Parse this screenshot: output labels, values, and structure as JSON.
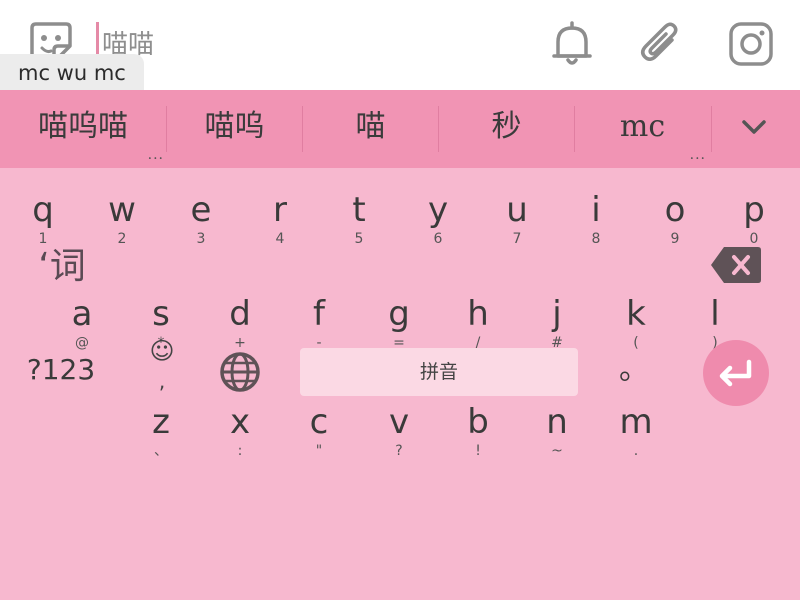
{
  "input": {
    "text": "喵喵",
    "composition": "mc wu mc"
  },
  "topbar": {
    "icons": [
      "emoji-sticker-icon",
      "bell-icon",
      "paperclip-icon",
      "instagram-icon"
    ]
  },
  "candidates": {
    "items": [
      "喵呜喵",
      "喵呜",
      "喵",
      "秒",
      "mc"
    ],
    "more_marker": "...",
    "expand_icon": "chevron-down-icon"
  },
  "keyboard": {
    "row1": [
      {
        "main": "q",
        "sub": "1"
      },
      {
        "main": "w",
        "sub": "2"
      },
      {
        "main": "e",
        "sub": "3"
      },
      {
        "main": "r",
        "sub": "4"
      },
      {
        "main": "t",
        "sub": "5"
      },
      {
        "main": "y",
        "sub": "6"
      },
      {
        "main": "u",
        "sub": "7"
      },
      {
        "main": "i",
        "sub": "8"
      },
      {
        "main": "o",
        "sub": "9"
      },
      {
        "main": "p",
        "sub": "0"
      }
    ],
    "row2": [
      {
        "main": "a",
        "sub": "@"
      },
      {
        "main": "s",
        "sub": "*"
      },
      {
        "main": "d",
        "sub": "+"
      },
      {
        "main": "f",
        "sub": "-"
      },
      {
        "main": "g",
        "sub": "="
      },
      {
        "main": "h",
        "sub": "/"
      },
      {
        "main": "j",
        "sub": "#"
      },
      {
        "main": "k",
        "sub": "("
      },
      {
        "main": "l",
        "sub": ")"
      }
    ],
    "row3": [
      {
        "main": "z",
        "sub": "、"
      },
      {
        "main": "x",
        "sub": ":"
      },
      {
        "main": "c",
        "sub": "\""
      },
      {
        "main": "v",
        "sub": "?"
      },
      {
        "main": "b",
        "sub": "!"
      },
      {
        "main": "n",
        "sub": "~"
      },
      {
        "main": "m",
        "sub": "."
      }
    ],
    "word_key": "‘词",
    "symbols_key": "?123",
    "emoji_key": {
      "main": "☺",
      "sub": ","
    },
    "space_label": "拼音",
    "period_key": "。",
    "colors": {
      "keyboard_bg": "#f7b8cf",
      "candidate_bg": "#f194b4",
      "accent": "#ef8bad",
      "space_bg": "#fbd9e4"
    }
  }
}
